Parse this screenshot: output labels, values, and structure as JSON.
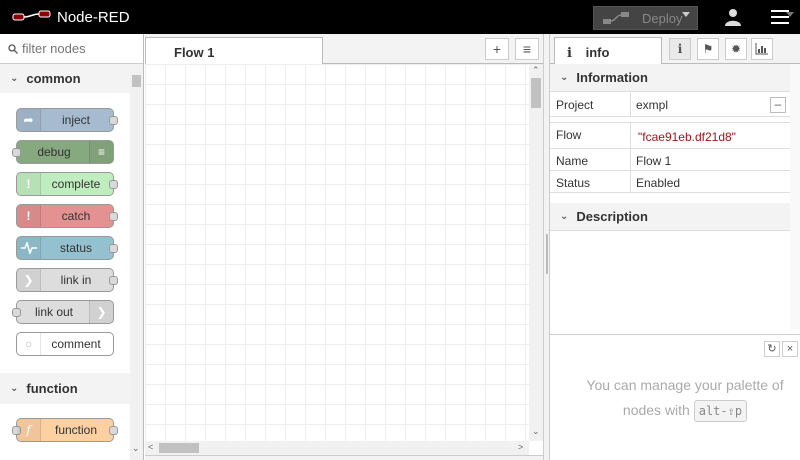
{
  "app": {
    "title": "Node-RED"
  },
  "header": {
    "deploy_label": "Deploy"
  },
  "palette": {
    "search_placeholder": "filter nodes",
    "categories": [
      {
        "name": "common",
        "nodes": [
          {
            "label": "inject",
            "color": "#a6bbcf",
            "icon": "arrow-icon"
          },
          {
            "label": "debug",
            "color": "#87a980",
            "icon": "list-icon"
          },
          {
            "label": "complete",
            "color": "#c0edc0",
            "icon": "exclamation-icon"
          },
          {
            "label": "catch",
            "color": "#e49191",
            "icon": "exclamation-icon"
          },
          {
            "label": "status",
            "color": "#94c1d0",
            "icon": "pulse-icon"
          },
          {
            "label": "link in",
            "color": "#dddddd",
            "icon": "link-icon"
          },
          {
            "label": "link out",
            "color": "#dddddd",
            "icon": "link-icon"
          },
          {
            "label": "comment",
            "color": "#ffffff",
            "icon": "comment-icon"
          }
        ]
      },
      {
        "name": "function",
        "nodes": [
          {
            "label": "function",
            "color": "#fdd0a2",
            "icon": "function-icon"
          }
        ]
      }
    ]
  },
  "workspace": {
    "tabs": [
      {
        "label": "Flow 1"
      }
    ]
  },
  "sidebar": {
    "active_tab": "info",
    "info": {
      "sections": {
        "information": "Information",
        "description": "Description"
      },
      "project": {
        "key": "Project",
        "value": "exmpl"
      },
      "flow": {
        "key": "Flow",
        "value": "\"fcae91eb.df21d8\""
      },
      "name": {
        "key": "Name",
        "value": "Flow 1"
      },
      "status": {
        "key": "Status",
        "value": "Enabled"
      }
    },
    "help": {
      "text_1": "You can manage your palette of",
      "text_2": "nodes with",
      "shortcut": "alt-⇧p"
    }
  }
}
